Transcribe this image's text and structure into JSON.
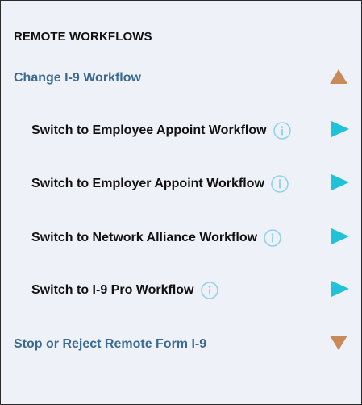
{
  "panel": {
    "heading": "REMOTE WORKFLOWS"
  },
  "sections": {
    "change": {
      "label": "Change I-9 Workflow",
      "icon": "triangle-up-icon",
      "expanded": true
    },
    "stop": {
      "label": "Stop or Reject Remote Form I-9",
      "icon": "triangle-down-icon",
      "expanded": false
    }
  },
  "items": [
    {
      "label": "Switch to Employee Appoint Workflow",
      "info_icon": "info-icon",
      "action_icon": "play-icon"
    },
    {
      "label": "Switch to Employer Appoint Workflow",
      "info_icon": "info-icon",
      "action_icon": "play-icon"
    },
    {
      "label": "Switch to Network Alliance Workflow",
      "info_icon": "info-icon",
      "action_icon": "play-icon"
    },
    {
      "label": "Switch to I-9 Pro Workflow",
      "info_icon": "info-icon",
      "action_icon": "play-icon"
    }
  ],
  "colors": {
    "section_text": "#3a6a91",
    "expand_triangle": "#c98a5a",
    "play_arrow": "#1fc2d8",
    "info_circle": "#8fd3ec",
    "panel_bg": "#eef1f7"
  }
}
